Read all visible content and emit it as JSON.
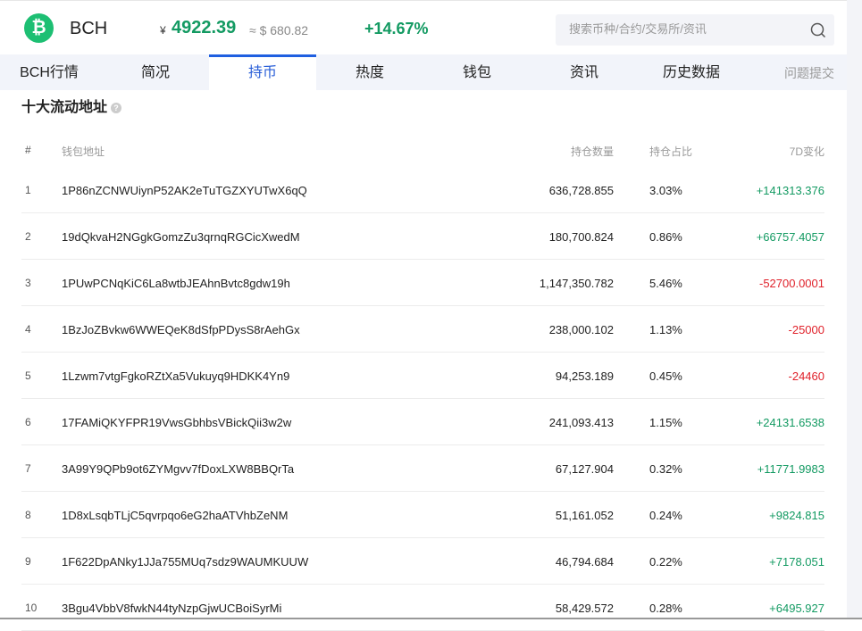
{
  "header": {
    "logo_glyph": "₿",
    "symbol": "BCH",
    "currency_symbol": "¥",
    "price": "4922.39",
    "usd_price": "≈ $ 680.82",
    "change": "+14.67%",
    "search_placeholder": "搜索币种/合约/交易所/资讯"
  },
  "tabs": [
    {
      "label": "BCH行情"
    },
    {
      "label": "简况"
    },
    {
      "label": "持币"
    },
    {
      "label": "热度"
    },
    {
      "label": "钱包"
    },
    {
      "label": "资讯"
    },
    {
      "label": "历史数据"
    },
    {
      "label": "问题提交"
    }
  ],
  "active_tab": "持币",
  "section": {
    "title": "十大流动地址",
    "help": "?"
  },
  "table": {
    "headers": {
      "rank": "#",
      "address": "钱包地址",
      "quantity": "持仓数量",
      "percent": "持仓占比",
      "change": "7D变化"
    },
    "rows": [
      {
        "rank": "1",
        "address": "1P86nZCNWUiynP52AK2eTuTGZXYUTwX6qQ",
        "quantity": "636,728.855",
        "percent": "3.03%",
        "change": "+141313.376"
      },
      {
        "rank": "2",
        "address": "19dQkvaH2NGgkGomzZu3qrnqRGCicXwedM",
        "quantity": "180,700.824",
        "percent": "0.86%",
        "change": "+66757.4057"
      },
      {
        "rank": "3",
        "address": "1PUwPCNqKiC6La8wtbJEAhnBvtc8gdw19h",
        "quantity": "1,147,350.782",
        "percent": "5.46%",
        "change": "-52700.0001"
      },
      {
        "rank": "4",
        "address": "1BzJoZBvkw6WWEQeK8dSfpPDysS8rAehGx",
        "quantity": "238,000.102",
        "percent": "1.13%",
        "change": "-25000"
      },
      {
        "rank": "5",
        "address": "1Lzwm7vtgFgkoRZtXa5Vukuyq9HDKK4Yn9",
        "quantity": "94,253.189",
        "percent": "0.45%",
        "change": "-24460"
      },
      {
        "rank": "6",
        "address": "17FAMiQKYFPR19VwsGbhbsVBickQii3w2w",
        "quantity": "241,093.413",
        "percent": "1.15%",
        "change": "+24131.6538"
      },
      {
        "rank": "7",
        "address": "3A99Y9QPb9ot6ZYMgvv7fDoxLXW8BBQrTa",
        "quantity": "67,127.904",
        "percent": "0.32%",
        "change": "+11771.9983"
      },
      {
        "rank": "8",
        "address": "1D8xLsqbTLjC5qvrpqo6eG2haATVhbZeNM",
        "quantity": "51,161.052",
        "percent": "0.24%",
        "change": "+9824.815"
      },
      {
        "rank": "9",
        "address": "1F622DpANky1JJa755MUq7sdz9WAUMKUUW",
        "quantity": "46,794.684",
        "percent": "0.22%",
        "change": "+7178.051"
      },
      {
        "rank": "10",
        "address": "3Bgu4VbbV8fwkN44tyNzpGjwUCBoiSyrMi",
        "quantity": "58,429.572",
        "percent": "0.28%",
        "change": "+6495.927"
      }
    ]
  },
  "colors": {
    "positive": "#139a62",
    "negative": "#e0222b",
    "accent": "#1f5fe0"
  }
}
